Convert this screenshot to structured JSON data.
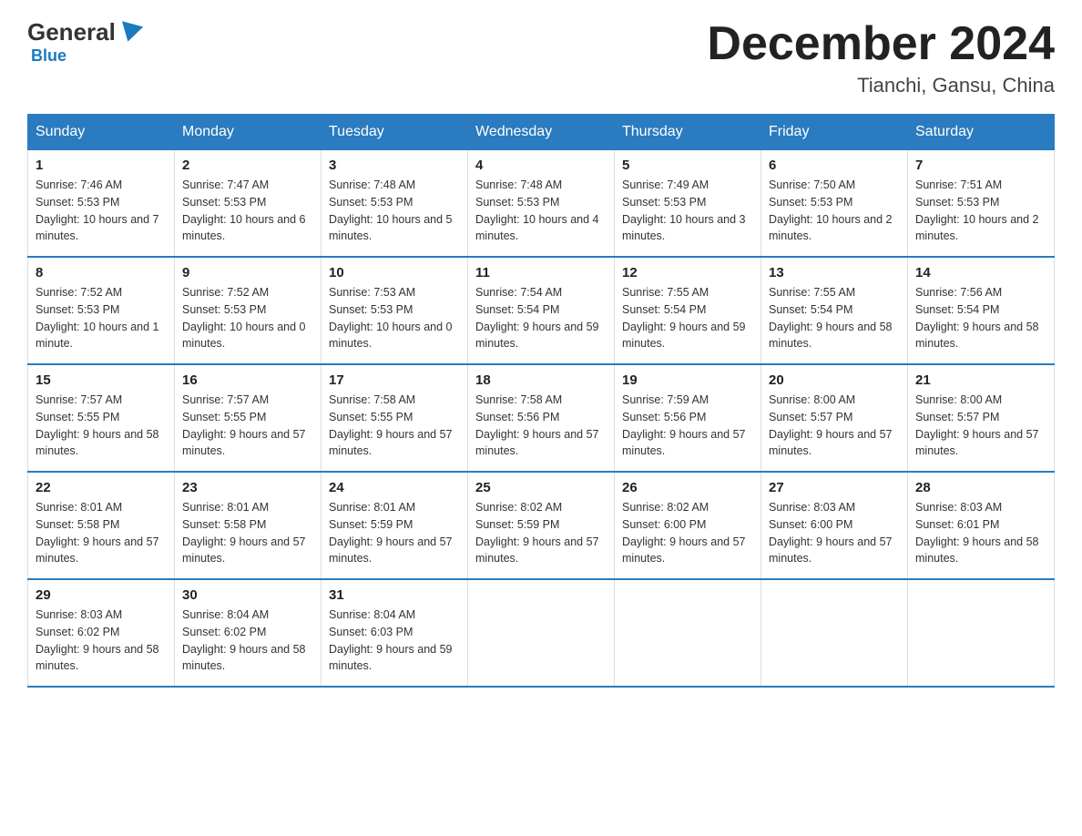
{
  "header": {
    "logo_general": "General",
    "logo_blue": "Blue",
    "calendar_title": "December 2024",
    "location": "Tianchi, Gansu, China"
  },
  "days_of_week": [
    "Sunday",
    "Monday",
    "Tuesday",
    "Wednesday",
    "Thursday",
    "Friday",
    "Saturday"
  ],
  "weeks": [
    [
      {
        "day": "1",
        "sunrise": "7:46 AM",
        "sunset": "5:53 PM",
        "daylight": "10 hours and 7 minutes."
      },
      {
        "day": "2",
        "sunrise": "7:47 AM",
        "sunset": "5:53 PM",
        "daylight": "10 hours and 6 minutes."
      },
      {
        "day": "3",
        "sunrise": "7:48 AM",
        "sunset": "5:53 PM",
        "daylight": "10 hours and 5 minutes."
      },
      {
        "day": "4",
        "sunrise": "7:48 AM",
        "sunset": "5:53 PM",
        "daylight": "10 hours and 4 minutes."
      },
      {
        "day": "5",
        "sunrise": "7:49 AM",
        "sunset": "5:53 PM",
        "daylight": "10 hours and 3 minutes."
      },
      {
        "day": "6",
        "sunrise": "7:50 AM",
        "sunset": "5:53 PM",
        "daylight": "10 hours and 2 minutes."
      },
      {
        "day": "7",
        "sunrise": "7:51 AM",
        "sunset": "5:53 PM",
        "daylight": "10 hours and 2 minutes."
      }
    ],
    [
      {
        "day": "8",
        "sunrise": "7:52 AM",
        "sunset": "5:53 PM",
        "daylight": "10 hours and 1 minute."
      },
      {
        "day": "9",
        "sunrise": "7:52 AM",
        "sunset": "5:53 PM",
        "daylight": "10 hours and 0 minutes."
      },
      {
        "day": "10",
        "sunrise": "7:53 AM",
        "sunset": "5:53 PM",
        "daylight": "10 hours and 0 minutes."
      },
      {
        "day": "11",
        "sunrise": "7:54 AM",
        "sunset": "5:54 PM",
        "daylight": "9 hours and 59 minutes."
      },
      {
        "day": "12",
        "sunrise": "7:55 AM",
        "sunset": "5:54 PM",
        "daylight": "9 hours and 59 minutes."
      },
      {
        "day": "13",
        "sunrise": "7:55 AM",
        "sunset": "5:54 PM",
        "daylight": "9 hours and 58 minutes."
      },
      {
        "day": "14",
        "sunrise": "7:56 AM",
        "sunset": "5:54 PM",
        "daylight": "9 hours and 58 minutes."
      }
    ],
    [
      {
        "day": "15",
        "sunrise": "7:57 AM",
        "sunset": "5:55 PM",
        "daylight": "9 hours and 58 minutes."
      },
      {
        "day": "16",
        "sunrise": "7:57 AM",
        "sunset": "5:55 PM",
        "daylight": "9 hours and 57 minutes."
      },
      {
        "day": "17",
        "sunrise": "7:58 AM",
        "sunset": "5:55 PM",
        "daylight": "9 hours and 57 minutes."
      },
      {
        "day": "18",
        "sunrise": "7:58 AM",
        "sunset": "5:56 PM",
        "daylight": "9 hours and 57 minutes."
      },
      {
        "day": "19",
        "sunrise": "7:59 AM",
        "sunset": "5:56 PM",
        "daylight": "9 hours and 57 minutes."
      },
      {
        "day": "20",
        "sunrise": "8:00 AM",
        "sunset": "5:57 PM",
        "daylight": "9 hours and 57 minutes."
      },
      {
        "day": "21",
        "sunrise": "8:00 AM",
        "sunset": "5:57 PM",
        "daylight": "9 hours and 57 minutes."
      }
    ],
    [
      {
        "day": "22",
        "sunrise": "8:01 AM",
        "sunset": "5:58 PM",
        "daylight": "9 hours and 57 minutes."
      },
      {
        "day": "23",
        "sunrise": "8:01 AM",
        "sunset": "5:58 PM",
        "daylight": "9 hours and 57 minutes."
      },
      {
        "day": "24",
        "sunrise": "8:01 AM",
        "sunset": "5:59 PM",
        "daylight": "9 hours and 57 minutes."
      },
      {
        "day": "25",
        "sunrise": "8:02 AM",
        "sunset": "5:59 PM",
        "daylight": "9 hours and 57 minutes."
      },
      {
        "day": "26",
        "sunrise": "8:02 AM",
        "sunset": "6:00 PM",
        "daylight": "9 hours and 57 minutes."
      },
      {
        "day": "27",
        "sunrise": "8:03 AM",
        "sunset": "6:00 PM",
        "daylight": "9 hours and 57 minutes."
      },
      {
        "day": "28",
        "sunrise": "8:03 AM",
        "sunset": "6:01 PM",
        "daylight": "9 hours and 58 minutes."
      }
    ],
    [
      {
        "day": "29",
        "sunrise": "8:03 AM",
        "sunset": "6:02 PM",
        "daylight": "9 hours and 58 minutes."
      },
      {
        "day": "30",
        "sunrise": "8:04 AM",
        "sunset": "6:02 PM",
        "daylight": "9 hours and 58 minutes."
      },
      {
        "day": "31",
        "sunrise": "8:04 AM",
        "sunset": "6:03 PM",
        "daylight": "9 hours and 59 minutes."
      },
      null,
      null,
      null,
      null
    ]
  ],
  "sunrise_label": "Sunrise: ",
  "sunset_label": "Sunset: ",
  "daylight_label": "Daylight: "
}
